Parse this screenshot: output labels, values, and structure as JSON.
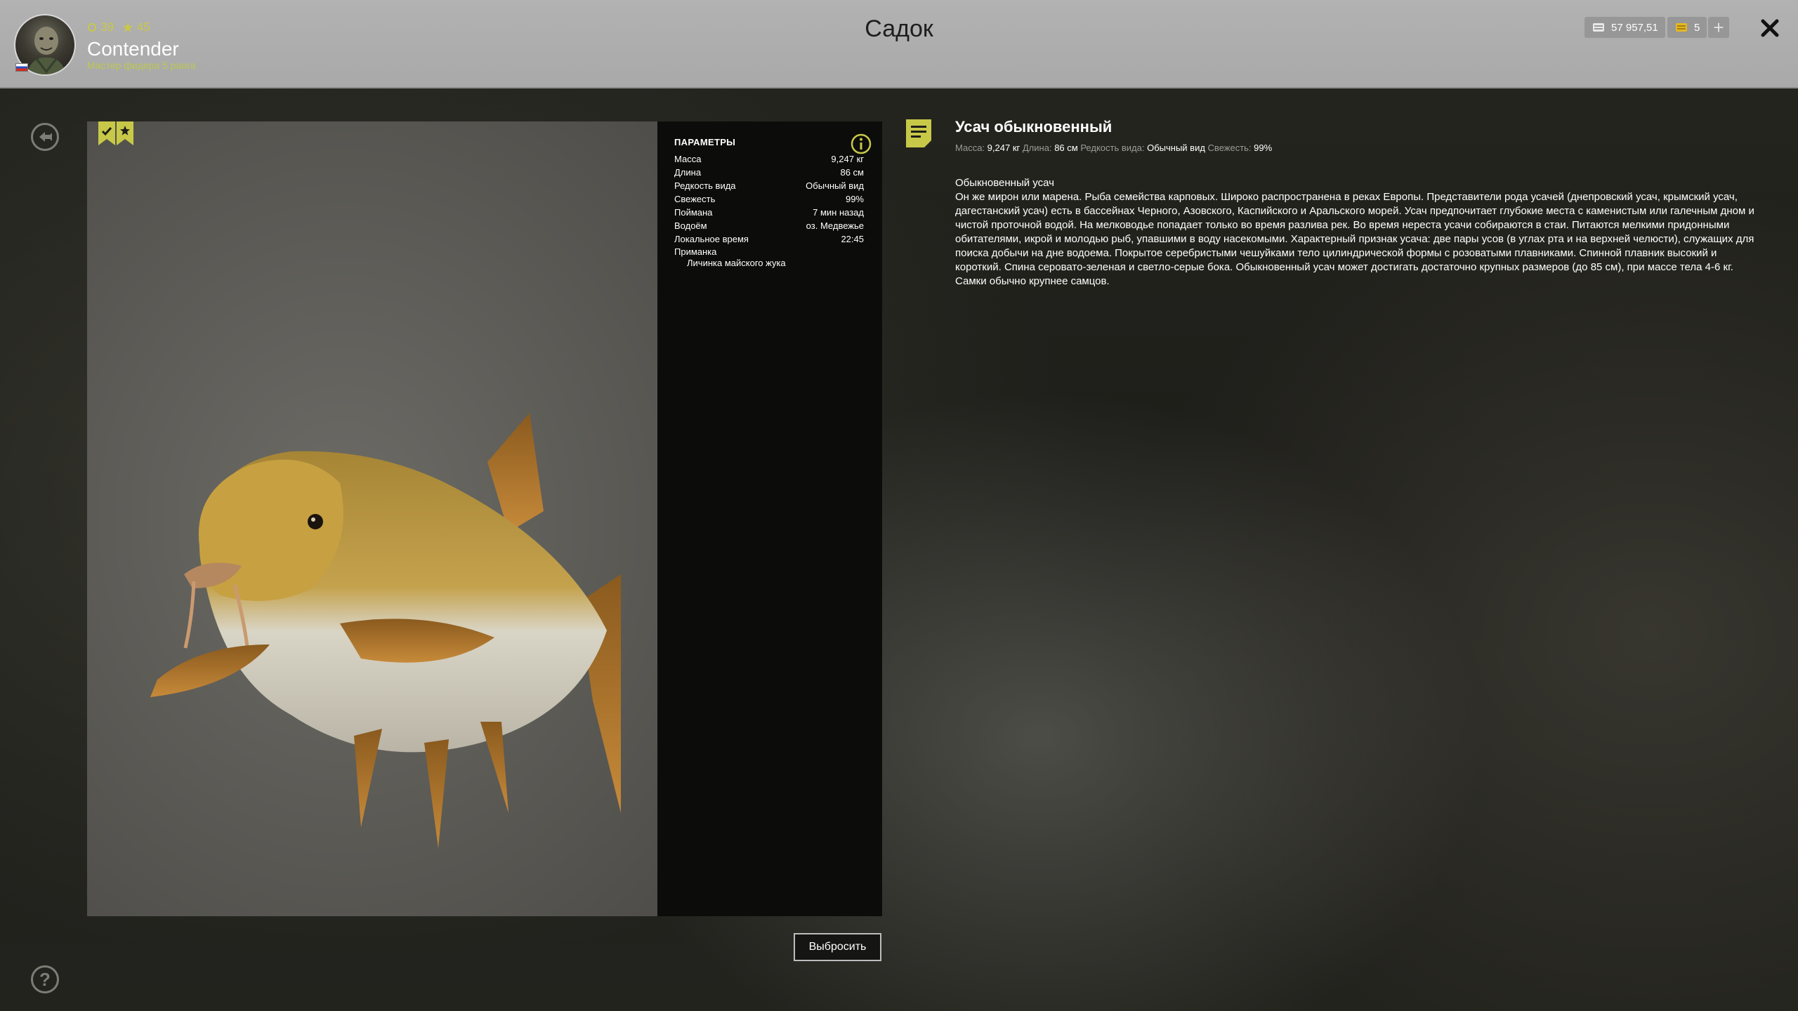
{
  "header": {
    "title": "Садок",
    "player": {
      "level": "39",
      "stars": "45",
      "name": "Contender",
      "rank": "Мастер фидера 5 ранга"
    },
    "currency": {
      "silver": "57 957,51",
      "gold": "5",
      "add_label": "+"
    },
    "close_label": "✕"
  },
  "sidebar": {
    "help_label": "?"
  },
  "params": {
    "title": "ПАРАМЕТРЫ",
    "rows": [
      {
        "label": "Масса",
        "value": "9,247 кг"
      },
      {
        "label": "Длина",
        "value": "86 см"
      },
      {
        "label": "Редкость вида",
        "value": "Обычный вид"
      },
      {
        "label": "Свежесть",
        "value": "99%"
      },
      {
        "label": "Поймана",
        "value": "7 мин назад"
      },
      {
        "label": "Водоём",
        "value": "оз. Медвежье"
      },
      {
        "label": "Локальное время",
        "value": "22:45"
      }
    ],
    "bait_label": "Приманка",
    "bait_value": "Личинка майского жука"
  },
  "actions": {
    "discard_label": "Выбросить"
  },
  "description": {
    "name": "Усач обыкновенный",
    "summary": {
      "mass_label": "Масса:",
      "mass_value": "9,247 кг",
      "length_label": "Длина:",
      "length_value": "86 см",
      "rarity_label": "Редкость вида:",
      "rarity_value": "Обычный вид",
      "freshness_label": "Свежесть:",
      "freshness_value": "99%"
    },
    "subtitle": "Обыкновенный усач",
    "text": "Он же мирон или марена. Рыба семейства карповых. Широко распространена в реках Европы. Представители рода усачей (днепровский усач, крымский усач, дагестанский усач) есть в бассейнах Черного, Азовского, Каспийского и Аральского морей. Усач предпочитает глубокие места с каменистым или галечным дном и чистой проточной водой. На мелководье попадает только во время разлива рек. Во время нереста усачи собираются в стаи. Питаются мелкими придонными обитателями, икрой и молодью рыб, упавшими в воду насекомыми. Характерный признак усача: две пары усов (в углах рта и на верхней челюсти), служащих для поиска добычи на дне водоема. Покрытое серебристыми чешуйками тело цилиндрической формы с розоватыми плавниками. Спинной плавник высокий и короткий. Спина серовато-зеленая и светло-серые бока. Обыкновенный усач может достигать достаточно крупных размеров (до 85 см), при массе тела 4-6 кг. Самки обычно крупнее самцов."
  },
  "colors": {
    "accent": "#c8c848",
    "topbar": "#b0b0b0",
    "panel": "#0c0c0b"
  }
}
